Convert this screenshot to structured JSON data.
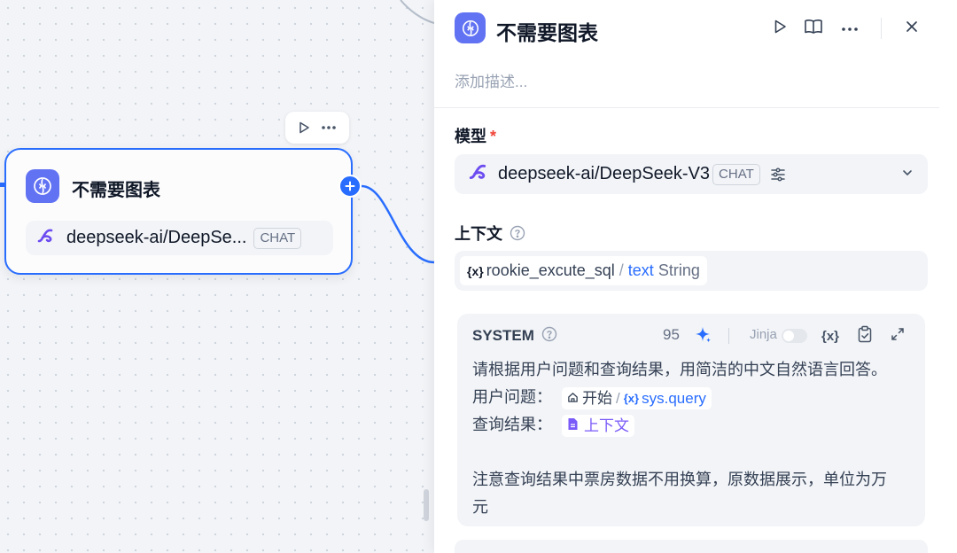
{
  "canvas": {
    "node": {
      "title": "不需要图表",
      "model_name": "deepseek-ai/DeepSe...",
      "model_badge": "CHAT"
    }
  },
  "panel": {
    "title": "不需要图表",
    "description_placeholder": "添加描述...",
    "model_section": {
      "label": "模型",
      "required_mark": "*",
      "model_name": "deepseek-ai/DeepSeek-V3",
      "model_badge": "CHAT"
    },
    "context_section": {
      "label": "上下文",
      "variable": {
        "brace": "{x}",
        "name": "rookie_excute_sql",
        "separator": "/",
        "field": "text",
        "type": "String"
      }
    },
    "system_prompt": {
      "label": "SYSTEM",
      "char_count": "95",
      "jinja_label": "Jinja",
      "jinja_enabled": false,
      "line1": "请根据用户问题和查询结果，用简洁的中文自然语言回答。",
      "line2_label": "用户问题：",
      "line2_ref_node": "开始",
      "line2_ref_sep": "/",
      "line2_ref_brace": "{x}",
      "line2_ref_var": "sys.query",
      "line3_label": "查询结果：",
      "line3_ref": "上下文",
      "line4": "注意查询结果中票房数据不用换算，原数据展示，单位为万",
      "line5": "元",
      "var_insert_label": "{x}"
    }
  },
  "colors": {
    "accent": "#296dff",
    "node_icon_bg": "#6172f3",
    "deepseek_purple": "#6c4cf1",
    "required": "#f04438"
  }
}
